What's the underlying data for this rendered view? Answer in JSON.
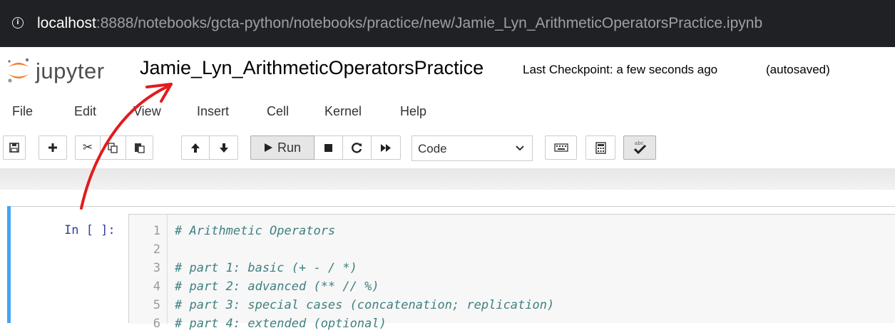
{
  "browser": {
    "url_host": "localhost",
    "url_rest": ":8888/notebooks/gcta-python/notebooks/practice/new/Jamie_Lyn_ArithmeticOperatorsPractice.ipynb",
    "info_icon": "info-icon"
  },
  "header": {
    "logo_text": "jupyter",
    "notebook_title": "Jamie_Lyn_ArithmeticOperatorsPractice",
    "checkpoint": "Last Checkpoint: a few seconds ago",
    "autosave": "(autosaved)"
  },
  "menu": {
    "items": [
      {
        "label": "File"
      },
      {
        "label": "Edit"
      },
      {
        "label": "View"
      },
      {
        "label": "Insert"
      },
      {
        "label": "Cell"
      },
      {
        "label": "Kernel"
      },
      {
        "label": "Help"
      }
    ]
  },
  "toolbar": {
    "run_label": "Run",
    "cell_type": "Code",
    "icons": [
      "save-icon",
      "plus-icon",
      "cut-icon",
      "copy-icon",
      "paste-icon",
      "arrow-up-icon",
      "arrow-down-icon",
      "play-icon",
      "stop-icon",
      "restart-icon",
      "fast-forward-icon",
      "chevron-down-icon",
      "keyboard-icon",
      "calculator-icon",
      "spellcheck-icon"
    ]
  },
  "cell": {
    "prompt": "In [ ]:",
    "lines": [
      {
        "num": "1",
        "text": "# Arithmetic Operators"
      },
      {
        "num": "2",
        "text": ""
      },
      {
        "num": "3",
        "text": "# part 1: basic (+ - / *)"
      },
      {
        "num": "4",
        "text": "# part 2: advanced (** // %)"
      },
      {
        "num": "5",
        "text": "# part 3: special cases (concatenation; replication)"
      },
      {
        "num": "6",
        "text": "# part 4: extended (optional)"
      }
    ]
  },
  "colors": {
    "urlbar_bg": "#202124",
    "cell_selected_bar": "#42a5f5",
    "prompt": "#303f9f",
    "comment": "#408080",
    "logo_orange": "#f37726",
    "annotation_arrow": "#e21b1b"
  }
}
